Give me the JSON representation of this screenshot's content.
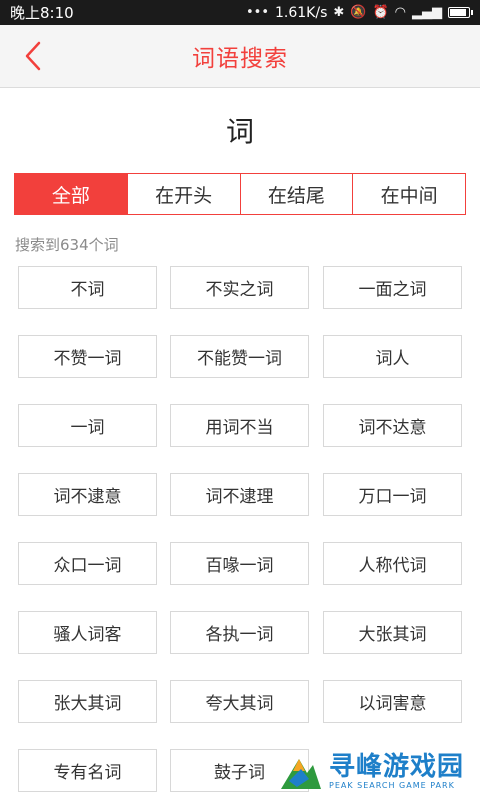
{
  "status_bar": {
    "time": "晚上8:10",
    "network_speed": "1.61K/s"
  },
  "header": {
    "title": "词语搜索"
  },
  "query": "词",
  "tabs": [
    "全部",
    "在开头",
    "在结尾",
    "在中间"
  ],
  "active_tab": "全部",
  "result_count": "搜索到634个词",
  "words": [
    "不词",
    "不实之词",
    "一面之词",
    "不赞一词",
    "不能赞一词",
    "词人",
    "一词",
    "用词不当",
    "词不达意",
    "词不逮意",
    "词不逮理",
    "万口一词",
    "众口一词",
    "百喙一词",
    "人称代词",
    "骚人词客",
    "各执一词",
    "大张其词",
    "张大其词",
    "夸大其词",
    "以词害意",
    "专有名词",
    "鼓子词",
    ""
  ],
  "watermark": {
    "main": "寻峰游戏园",
    "sub": "PEAK SEARCH GAME PARK"
  },
  "colors": {
    "accent": "#f2403c",
    "watermark": "#1e7fc9"
  }
}
